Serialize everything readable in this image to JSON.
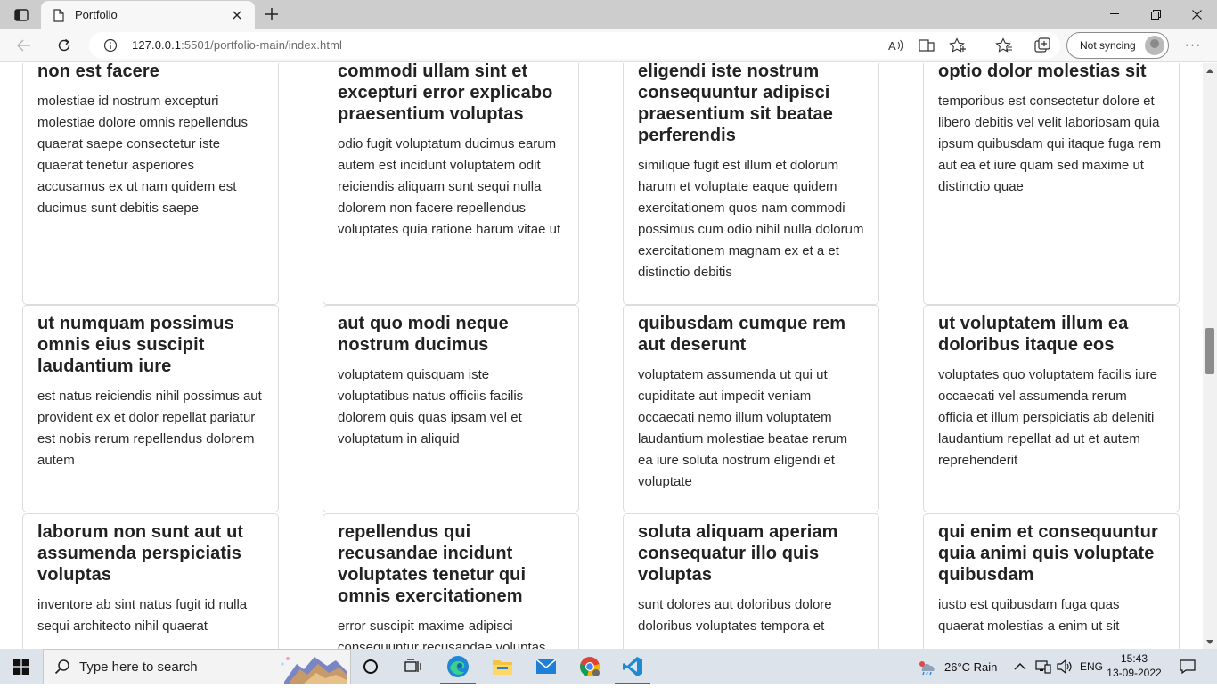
{
  "browser": {
    "tab_title": "Portfolio",
    "url_host": "127.0.0.1",
    "url_rest": ":5501/portfolio-main/index.html",
    "sync_label": "Not syncing",
    "more_label": "···"
  },
  "cards": [
    {
      "title": "non est facere",
      "body": "molestiae id nostrum excepturi molestiae dolore omnis repellendus quaerat saepe consectetur iste quaerat tenetur asperiores accusamus ex ut nam quidem est ducimus sunt debitis saepe"
    },
    {
      "title": "commodi ullam sint et excepturi error explicabo praesentium voluptas",
      "body": "odio fugit voluptatum ducimus earum autem est incidunt voluptatem odit reiciendis aliquam sunt sequi nulla dolorem non facere repellendus voluptates quia ratione harum vitae ut"
    },
    {
      "title": "eligendi iste nostrum consequuntur adipisci praesentium sit beatae perferendis",
      "body": "similique fugit est illum et dolorum harum et voluptate eaque quidem exercitationem quos nam commodi possimus cum odio nihil nulla dolorum exercitationem magnam ex et a et distinctio debitis"
    },
    {
      "title": "optio dolor molestias sit",
      "body": "temporibus est consectetur dolore et libero debitis vel velit laboriosam quia ipsum quibusdam qui itaque fuga rem aut ea et iure quam sed maxime ut distinctio quae"
    },
    {
      "title": "ut numquam possimus omnis eius suscipit laudantium iure",
      "body": "est natus reiciendis nihil possimus aut provident ex et dolor repellat pariatur est nobis rerum repellendus dolorem autem"
    },
    {
      "title": "aut quo modi neque nostrum ducimus",
      "body": "voluptatem quisquam iste voluptatibus natus officiis facilis dolorem quis quas ipsam vel et voluptatum in aliquid"
    },
    {
      "title": "quibusdam cumque rem aut deserunt",
      "body": "voluptatem assumenda ut qui ut cupiditate aut impedit veniam occaecati nemo illum voluptatem laudantium molestiae beatae rerum ea iure soluta nostrum eligendi et voluptate"
    },
    {
      "title": "ut voluptatem illum ea doloribus itaque eos",
      "body": "voluptates quo voluptatem facilis iure occaecati vel assumenda rerum officia et illum perspiciatis ab deleniti laudantium repellat ad ut et autem reprehenderit"
    },
    {
      "title": "laborum non sunt aut ut assumenda perspiciatis voluptas",
      "body": "inventore ab sint natus fugit id nulla sequi architecto nihil quaerat"
    },
    {
      "title": "repellendus qui recusandae incidunt voluptates tenetur qui omnis exercitationem",
      "body": "error suscipit maxime adipisci consequuntur recusandae voluptas"
    },
    {
      "title": "soluta aliquam aperiam consequatur illo quis voluptas",
      "body": "sunt dolores aut doloribus dolore doloribus voluptates tempora et"
    },
    {
      "title": "qui enim et consequuntur quia animi quis voluptate quibusdam",
      "body": "iusto est quibusdam fuga quas quaerat molestias a enim ut sit"
    }
  ],
  "taskbar": {
    "search_placeholder": "Type here to search",
    "weather": "26°C  Rain",
    "language": "ENG",
    "time": "15:43",
    "date": "13-09-2022"
  }
}
